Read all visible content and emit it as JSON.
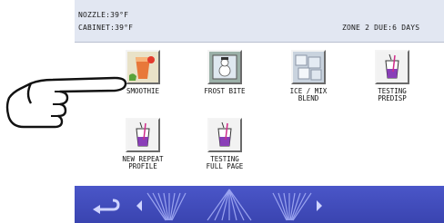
{
  "status": {
    "nozzle": "NOZZLE:39°F",
    "cabinet": "CABINET:39°F",
    "zone": "ZONE 2 DUE:6 DAYS"
  },
  "menu": {
    "items": [
      {
        "label": "SMOOTHIE",
        "icon": "smoothie-glass-icon"
      },
      {
        "label": "FROST BITE",
        "icon": "frost-bite-icon"
      },
      {
        "label": "ICE / MIX\nBLEND",
        "icon": "ice-cubes-icon"
      },
      {
        "label": "TESTING\nPREDISP",
        "icon": "dispense-cup-icon"
      },
      {
        "label": "NEW REPEAT\nPROFILE",
        "icon": "dispense-cup-icon"
      },
      {
        "label": "TESTING\nFULL PAGE",
        "icon": "dispense-cup-icon"
      }
    ]
  },
  "navbar": {
    "buttons": [
      "back-arrow-icon",
      "previous-page-icon",
      "up-icon",
      "next-page-icon"
    ]
  },
  "colors": {
    "status_bg": "#e2e7f2",
    "navbar_bg": "#3f4ab8"
  }
}
